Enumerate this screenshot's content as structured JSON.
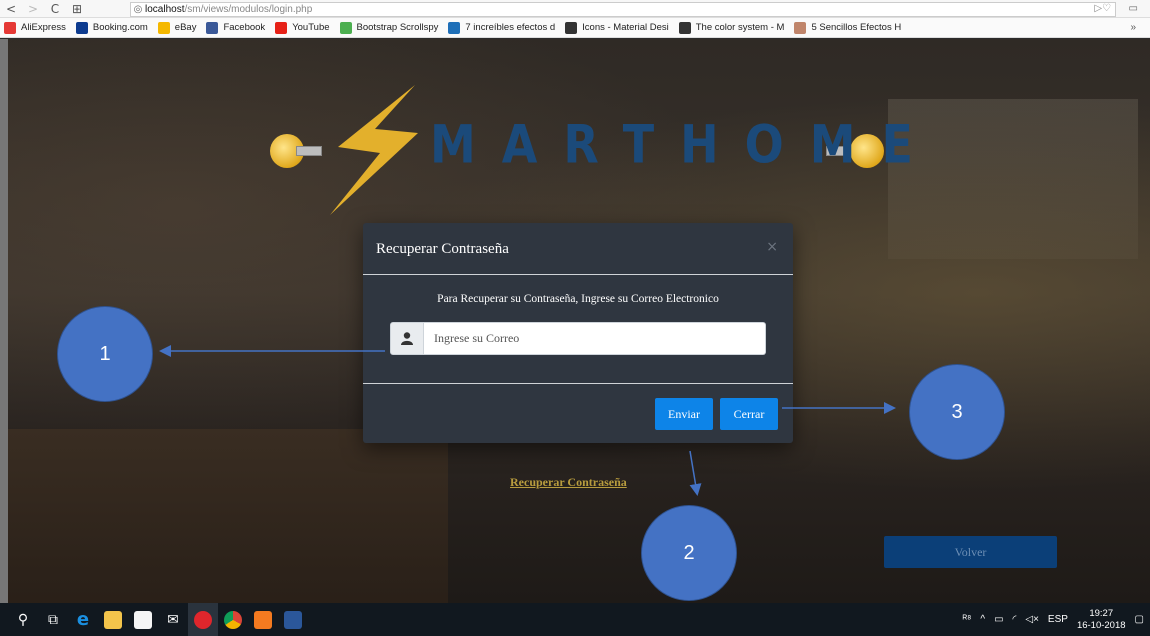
{
  "browser": {
    "url_host": "localhost",
    "url_path": "/sm/views/modulos/login.php",
    "bookmarks": [
      {
        "label": "AliExpress",
        "color": "#e53935"
      },
      {
        "label": "Booking.com",
        "color": "#0d3b8f"
      },
      {
        "label": "eBay",
        "color": "#f5b800"
      },
      {
        "label": "Facebook",
        "color": "#3b5998"
      },
      {
        "label": "YouTube",
        "color": "#e62117"
      },
      {
        "label": "Bootstrap Scrollspy",
        "color": "#4caf50"
      },
      {
        "label": "7 increíbles efectos d",
        "color": "#1e6fb8"
      },
      {
        "label": "Icons - Material Desi",
        "color": "#333333"
      },
      {
        "label": "The color system - M",
        "color": "#333333"
      },
      {
        "label": "5 Sencillos Efectos H",
        "color": "#c0856b"
      }
    ],
    "more_label": "»"
  },
  "logo": {
    "text": "MARTHOME",
    "color": "#1b4a7a",
    "bolt_color": "#e3b02c"
  },
  "modal": {
    "title": "Recuperar Contraseña",
    "close_glyph": "×",
    "message": "Para Recuperar su Contraseña, Ingrese su Correo Electronico",
    "email_placeholder": "Ingrese su Correo",
    "send_label": "Enviar",
    "close_label": "Cerrar"
  },
  "page": {
    "recover_link": "Recuperar Contraseña",
    "back_button": "Volver"
  },
  "annotations": {
    "badge_1": "1",
    "badge_2": "2",
    "badge_3": "3",
    "color": "#4472c4"
  },
  "taskbar": {
    "language": "ESP",
    "time": "19:27",
    "date": "16-10-2018"
  }
}
